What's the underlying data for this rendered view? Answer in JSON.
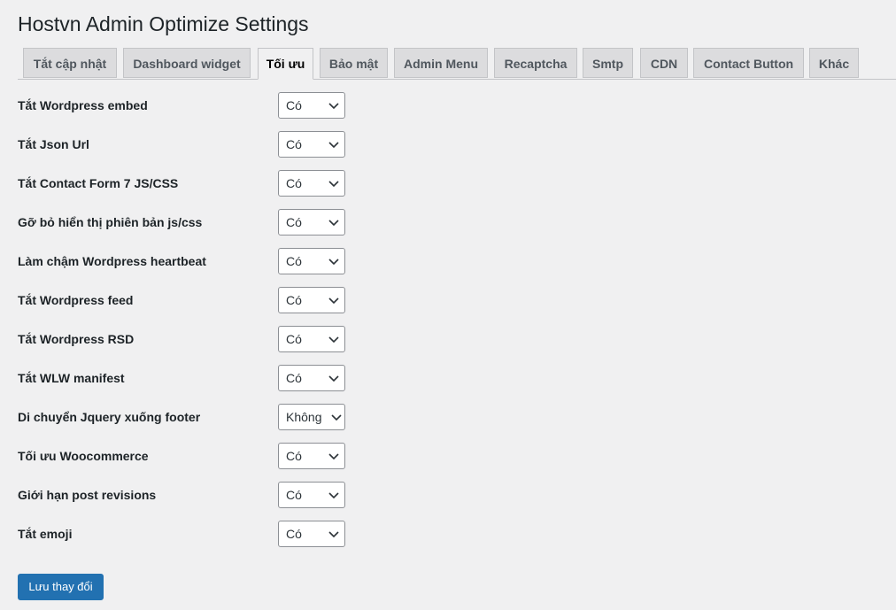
{
  "page": {
    "title": "Hostvn Admin Optimize Settings"
  },
  "tabs": [
    {
      "label": "Tắt cập nhật",
      "active": false
    },
    {
      "label": "Dashboard widget",
      "active": false
    },
    {
      "label": "Tối ưu",
      "active": true
    },
    {
      "label": "Bảo mật",
      "active": false
    },
    {
      "label": "Admin Menu",
      "active": false
    },
    {
      "label": "Recaptcha",
      "active": false
    },
    {
      "label": "Smtp",
      "active": false
    },
    {
      "label": "CDN",
      "active": false
    },
    {
      "label": "Contact Button",
      "active": false
    },
    {
      "label": "Khác",
      "active": false
    }
  ],
  "settings": [
    {
      "label": "Tắt Wordpress embed",
      "value": "Có"
    },
    {
      "label": "Tắt Json Url",
      "value": "Có"
    },
    {
      "label": "Tắt Contact Form 7 JS/CSS",
      "value": "Có"
    },
    {
      "label": "Gỡ bỏ hiển thị phiên bản js/css",
      "value": "Có"
    },
    {
      "label": "Làm chậm Wordpress heartbeat",
      "value": "Có"
    },
    {
      "label": "Tắt Wordpress feed",
      "value": "Có"
    },
    {
      "label": "Tắt Wordpress RSD",
      "value": "Có"
    },
    {
      "label": "Tắt WLW manifest",
      "value": "Có"
    },
    {
      "label": "Di chuyển Jquery xuống footer",
      "value": "Không"
    },
    {
      "label": "Tối ưu Woocommerce",
      "value": "Có"
    },
    {
      "label": "Giới hạn post revisions",
      "value": "Có"
    },
    {
      "label": "Tắt emoji",
      "value": "Có"
    }
  ],
  "actions": {
    "save_label": "Lưu thay đổi"
  },
  "colors": {
    "background": "#f0f0f1",
    "primary_button": "#2271b1",
    "tab_inactive": "#dcdcde"
  }
}
